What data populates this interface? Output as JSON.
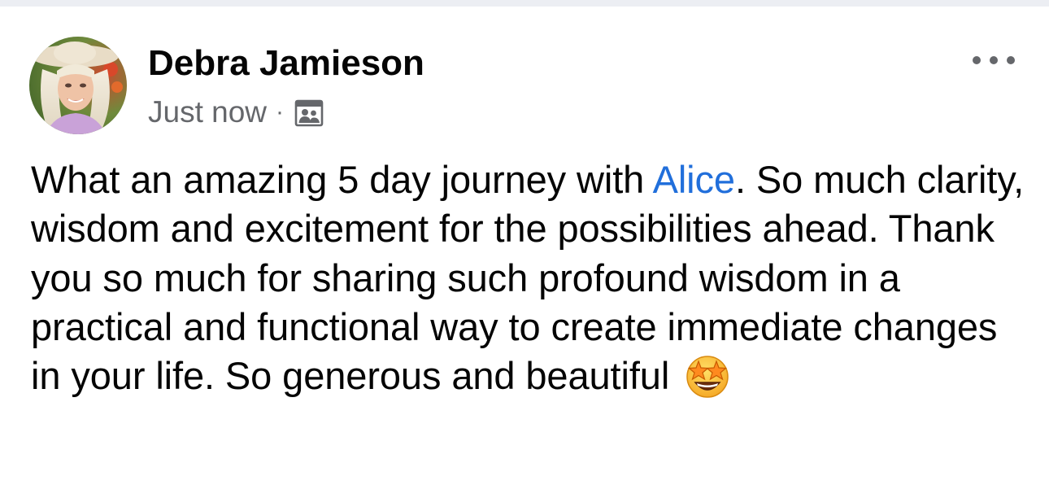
{
  "post": {
    "author": {
      "name": "Debra Jamieson",
      "avatar_icon": "profile-photo"
    },
    "timestamp": "Just now",
    "meta_separator": "·",
    "audience_icon": "friends-audience-icon",
    "more_options_icon": "ellipsis-icon",
    "body": {
      "text_part_1": "What an amazing 5 day journey with ",
      "mention": "Alice",
      "text_part_2": ". So much clarity, wisdom and excitement for the possibilities ahead. Thank you so much for sharing such profound wisdom in a practical and functional way to create immediate changes in your life. So generous and beautiful ",
      "emoji_icon": "star-struck-emoji"
    }
  },
  "colors": {
    "text_primary": "#050505",
    "text_secondary": "#65676b",
    "mention_link": "#216fdb",
    "divider": "#eceef3"
  }
}
